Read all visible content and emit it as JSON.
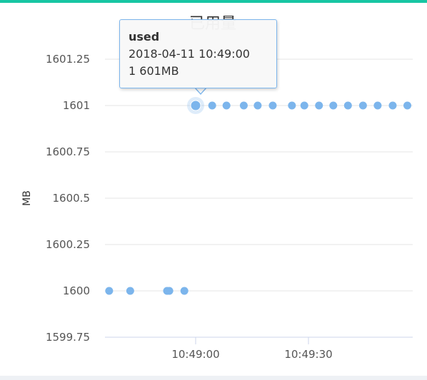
{
  "colors": {
    "accent": "#17c6a3",
    "series": "#7cb5ec",
    "grid": "#e6e6e6"
  },
  "chart_data": {
    "type": "scatter",
    "title": "已用量",
    "xlabel": "",
    "ylabel": "MB",
    "ylim": [
      1599.75,
      1601.4
    ],
    "y_ticks": [
      {
        "value": 1599.75,
        "label": "1599.75"
      },
      {
        "value": 1600,
        "label": "1600"
      },
      {
        "value": 1600.25,
        "label": "1600.25"
      },
      {
        "value": 1600.5,
        "label": "1600.5"
      },
      {
        "value": 1600.75,
        "label": "1600.75"
      },
      {
        "value": 1601,
        "label": "1601"
      },
      {
        "value": 1601.25,
        "label": "1601.25"
      }
    ],
    "x_ticks": [
      {
        "value": 0,
        "label": "10:49:00"
      },
      {
        "value": 30,
        "label": "10:49:30"
      }
    ],
    "xlim": [
      -24,
      57
    ],
    "grid": true,
    "series": [
      {
        "name": "used",
        "x": [
          -23,
          -17.4,
          -7.6,
          -7.0,
          -3.0,
          0,
          4.4,
          8.2,
          12.8,
          16.5,
          20.5,
          25.6,
          28.9,
          32.8,
          36.6,
          40.5,
          44.5,
          48.4,
          52.4,
          56.3
        ],
        "y": [
          1600,
          1600,
          1600,
          1600,
          1600,
          1601,
          1601,
          1601,
          1601,
          1601,
          1601,
          1601,
          1601,
          1601,
          1601,
          1601,
          1601,
          1601,
          1601,
          1601
        ]
      }
    ]
  },
  "tooltip": {
    "series_name": "used",
    "timestamp": "2018-04-11 10:49:00",
    "value": "1 601MB"
  }
}
